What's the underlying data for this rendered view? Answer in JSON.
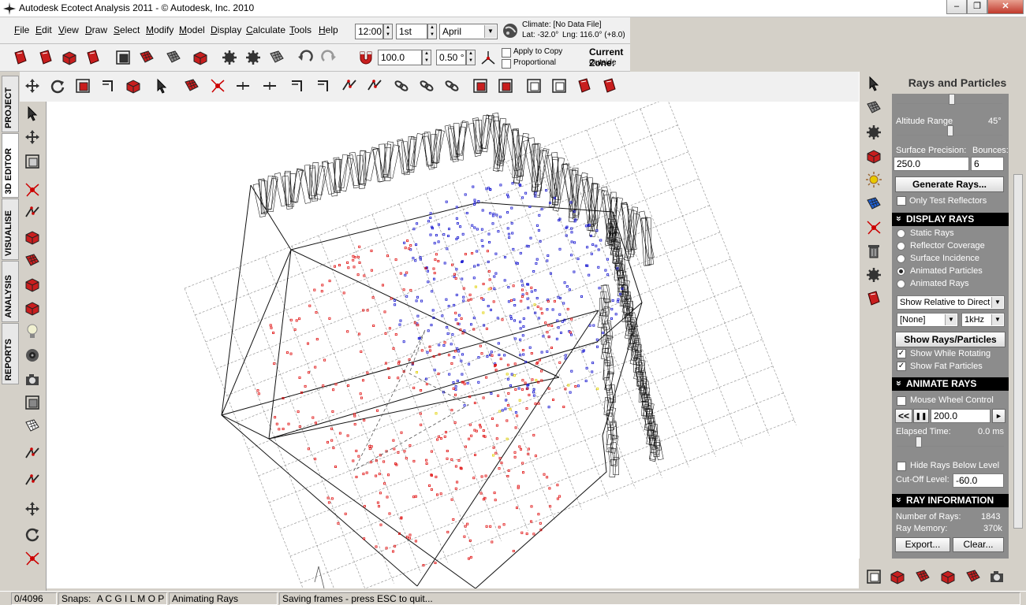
{
  "window": {
    "title": "Autodesk Ecotect Analysis 2011 - © Autodesk, Inc. 2010",
    "minimize": "–",
    "restore": "❐",
    "close": "✕"
  },
  "menu": [
    "File",
    "Edit",
    "View",
    "Draw",
    "Select",
    "Modify",
    "Model",
    "Display",
    "Calculate",
    "Tools",
    "Help"
  ],
  "datetime": {
    "time": "12:00",
    "day": "1st",
    "month": "April"
  },
  "climate": {
    "label": "Climate: [No Data File]",
    "lat": "Lat: -32.0°",
    "lng": "Lng: 116.0° (+8.0)"
  },
  "snap": {
    "grid": "100.0",
    "angle": "0.50 °",
    "apply_to_copy": "Apply to Copy",
    "proportional": "Proportional",
    "apply_to_copy_checked": false,
    "proportional_checked": false
  },
  "zone": {
    "label": "Current Zone:",
    "name": "Outside"
  },
  "left_tabs": [
    "PROJECT",
    "3D EDITOR",
    "VISUALISE",
    "ANALYSIS",
    "REPORTS"
  ],
  "active_tab": "3D EDITOR",
  "panel": {
    "title": "Rays and Particles",
    "altitude_label": "Altitude Range",
    "altitude_value": "45°",
    "altitude_level": 0.5,
    "surface_precision_label": "Surface Precision:",
    "bounces_label": "Bounces:",
    "surface_precision": "250.0",
    "bounces": "6",
    "generate_button": "Generate Rays...",
    "only_test_reflectors": "Only Test Reflectors",
    "display_rays_header": "DISPLAY RAYS",
    "display_options": [
      "Static Rays",
      "Reflector Coverage",
      "Surface Incidence",
      "Animated Particles",
      "Animated Rays"
    ],
    "display_selected": "Animated Particles",
    "relative_select": "Show Relative to Direct",
    "filter_select": "[None]",
    "freq_select": "1kHz",
    "show_button": "Show Rays/Particles",
    "show_while_rotating": "Show While Rotating",
    "show_fat_particles": "Show Fat Particles",
    "show_while_rotating_checked": true,
    "show_fat_particles_checked": true,
    "animate_header": "ANIMATE RAYS",
    "mouse_wheel_control": "Mouse Wheel Control",
    "rewind": "<<",
    "pause": "❚❚",
    "anim_value": "200.0",
    "play": "►",
    "elapsed_label": "Elapsed Time:",
    "elapsed_value": "0.0 ms",
    "hide_below": "Hide Rays Below Level",
    "cutoff_label": "Cut-Off Level:",
    "cutoff_value": "-60.0",
    "ray_info_header": "RAY INFORMATION",
    "num_rays_label": "Number of Rays:",
    "num_rays": "1843",
    "ray_memory_label": "Ray Memory:",
    "ray_memory": "370k",
    "export_button": "Export...",
    "clear_button": "Clear..."
  },
  "status": {
    "count": "0/4096",
    "snaps_label": "Snaps:",
    "snap_letters": "A C G I L M O P",
    "mode": "Animating Rays",
    "message": "Saving frames - press ESC to quit..."
  },
  "colors": {
    "particle_red": "#e01010",
    "particle_blue": "#1818d0",
    "particle_yellow": "#e0d000",
    "wire": "#111111",
    "grid": "#8a8a8a"
  }
}
